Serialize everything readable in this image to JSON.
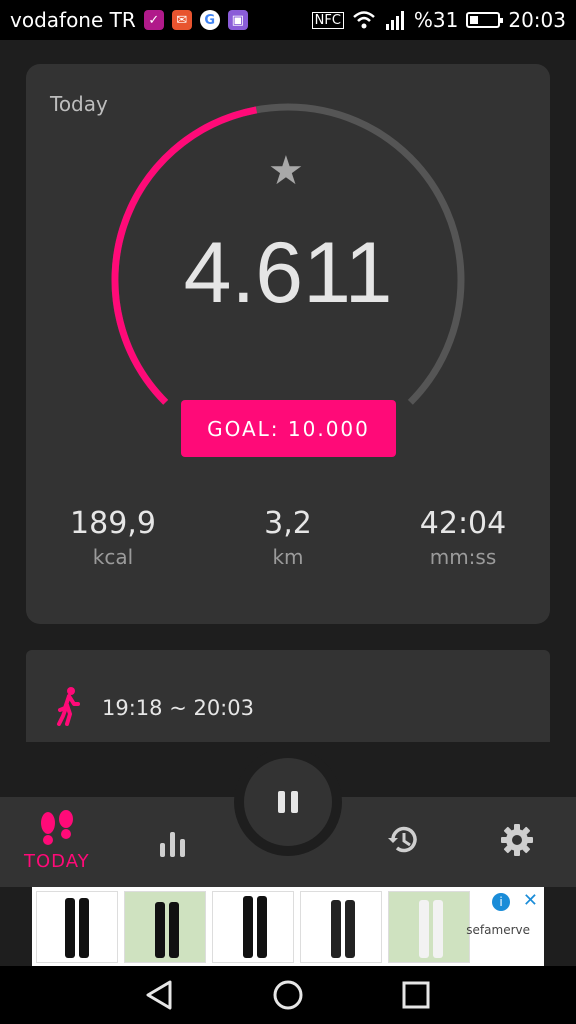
{
  "status_bar": {
    "carrier": "vodafone TR",
    "nfc": "NFC",
    "battery_percent": "%31",
    "battery_level": 0.31,
    "time": "20:03"
  },
  "main": {
    "today_label": "Today",
    "steps": "4.611",
    "progress_fraction": 0.4611,
    "goal_label": "GOAL: 10.000",
    "stats": [
      {
        "value": "189,9",
        "unit": "kcal"
      },
      {
        "value": "3,2",
        "unit": "km"
      },
      {
        "value": "42:04",
        "unit": "mm:ss"
      }
    ]
  },
  "activity": {
    "time_range": "19:18 ~ 20:03"
  },
  "bottom_nav": {
    "today_label": "TODAY"
  },
  "ad": {
    "brand": "sefamerve"
  },
  "colors": {
    "accent": "#ff0a78",
    "card": "#333333",
    "background": "#1e1e1e"
  }
}
